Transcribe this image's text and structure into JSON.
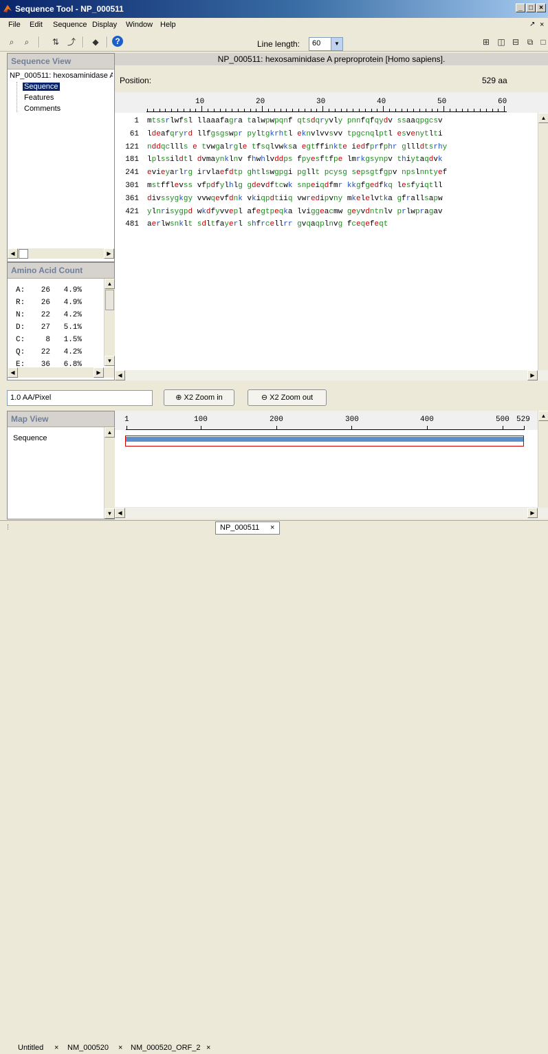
{
  "window": {
    "title": "Sequence Tool - NP_000511"
  },
  "menu": [
    "File",
    "Edit",
    "Sequence",
    "Display",
    "Window",
    "Help"
  ],
  "toolbar": {
    "line_length_label": "Line length:",
    "line_length_value": "60"
  },
  "sequence_view": {
    "header": "Sequence View",
    "tree_root": "NP_000511: hexosaminidase A",
    "tree_items": [
      "Sequence",
      "Features",
      "Comments"
    ]
  },
  "protein": {
    "title": "NP_000511: hexosaminidase A preproprotein [Homo sapiens].",
    "position_label": "Position:",
    "length": "529 aa",
    "ruler_ticks": [
      "10",
      "20",
      "30",
      "40",
      "50",
      "60"
    ]
  },
  "sequence_rows": [
    {
      "num": "1",
      "text": "mtssrlwfsl llaaafagra talwpwpqnf qtsdqryvly pnnfqfqydv ssaaqpgcsv"
    },
    {
      "num": "61",
      "text": "ldeafqryrd llfgsgswpr pyltgkrhtl eknvlvvsvv tpgcnqlptl esvenytlti"
    },
    {
      "num": "121",
      "text": "nddqcllls e tvwgalrgle tfsqlvwksa egtffinkte iedfprfphr gllldtsrhy"
    },
    {
      "num": "181",
      "text": "lplssildtl dvmaynklnv fhwhlvddps fpyesftfpe lmrkgsynpv thiytaqdvk"
    },
    {
      "num": "241",
      "text": "evieyarlrg irvlaefdtp ghtlswgpgi pgllt pcysg sepsgtfgpv npslnntyef"
    },
    {
      "num": "301",
      "text": "mstfflevss vfpdfylhlg gdevdftcwk snpeiqdfmr kkgfgedfkq lesfyiqtll"
    },
    {
      "num": "361",
      "text": "divssygkgy vvwqevfdnk vkiqpdtiiq vwredipvny mkelelvtka gfrallsapw"
    },
    {
      "num": "421",
      "text": "ylnrisygpd wkdfyvvepl afegtpeqka lviggeacmw geyvdntnlv prlwpragav"
    },
    {
      "num": "481",
      "text": "aerlwsnklt sdltfayerl shfrcellrr gvqaqplnvg fceqefeqt"
    }
  ],
  "amino_acid_count": {
    "header": "Amino Acid Count",
    "rows": [
      {
        "aa": "A:",
        "count": "26",
        "pct": "4.9%"
      },
      {
        "aa": "R:",
        "count": "26",
        "pct": "4.9%"
      },
      {
        "aa": "N:",
        "count": "22",
        "pct": "4.2%"
      },
      {
        "aa": "D:",
        "count": "27",
        "pct": "5.1%"
      },
      {
        "aa": "C:",
        "count": "8",
        "pct": "1.5%"
      },
      {
        "aa": "Q:",
        "count": "22",
        "pct": "4.2%"
      },
      {
        "aa": "E:",
        "count": "36",
        "pct": "6.8%"
      }
    ]
  },
  "zoom": {
    "scale_value": "1.0 AA/Pixel",
    "zoom_in": "X2 Zoom in",
    "zoom_out": "X2 Zoom out"
  },
  "map_view": {
    "header": "Map View",
    "item": "Sequence",
    "ruler_labels": [
      "1",
      "100",
      "200",
      "300",
      "400",
      "500",
      "529"
    ]
  },
  "tabs": [
    {
      "label": "Untitled",
      "active": false
    },
    {
      "label": "NM_000520",
      "active": false
    },
    {
      "label": "NM_000520_ORF_2",
      "active": false
    },
    {
      "label": "NP_000511",
      "active": true
    }
  ],
  "colors": {
    "title_bar": "#0a246a",
    "selection": "#0a246a",
    "map_bar": "#5a8fc8",
    "map_outline": "#cc0000"
  }
}
